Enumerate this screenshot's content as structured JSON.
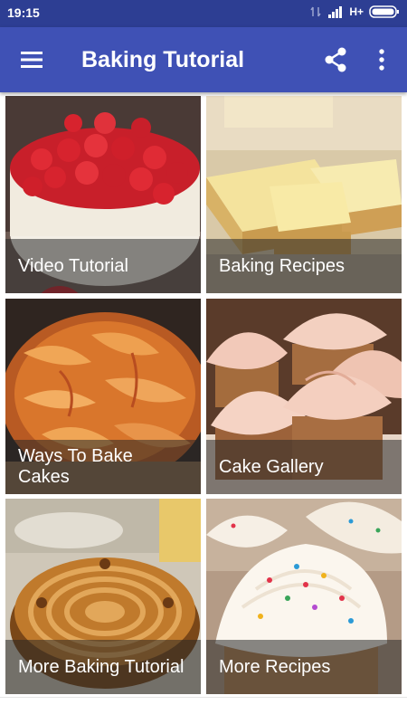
{
  "status_bar": {
    "time": "19:15",
    "network": "H+"
  },
  "app_bar": {
    "title": "Baking Tutorial",
    "menu_icon": "hamburger-menu-icon",
    "share_icon": "share-icon",
    "more_icon": "more-vert-icon"
  },
  "colors": {
    "status_bar": "#2d3e93",
    "app_bar": "#3f51b5",
    "caption_overlay": "rgba(40,40,40,0.55)"
  },
  "tiles": [
    {
      "label": "Video Tutorial",
      "image": "strawberry-cheesecake"
    },
    {
      "label": "Baking Recipes",
      "image": "lemon-bars"
    },
    {
      "label": "Ways To Bake Cakes",
      "image": "peach-tart"
    },
    {
      "label": "Cake Gallery",
      "image": "frosted-cupcakes"
    },
    {
      "label": "More Baking Tutorial",
      "image": "spiral-pie"
    },
    {
      "label": "More Recipes",
      "image": "sprinkle-cupcakes"
    }
  ]
}
